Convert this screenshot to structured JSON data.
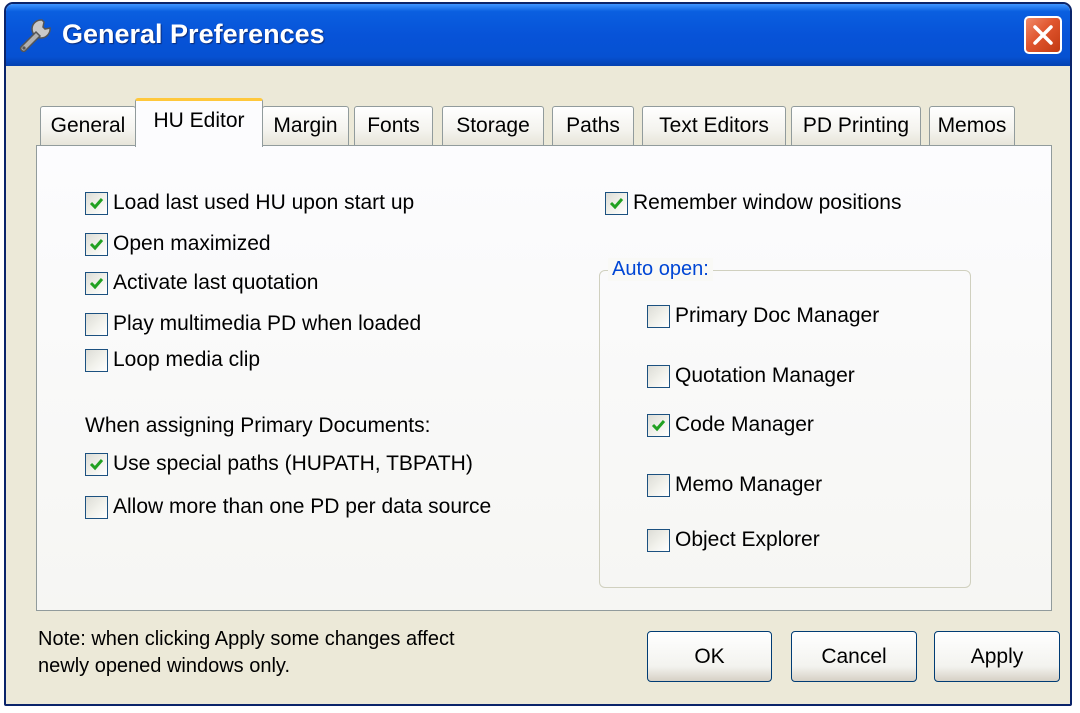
{
  "window": {
    "title": "General Preferences",
    "title_icon": "wrench-icon",
    "close_icon": "close-icon"
  },
  "tabs": [
    {
      "label": "General",
      "active": false
    },
    {
      "label": "HU Editor",
      "active": true
    },
    {
      "label": "Margin",
      "active": false
    },
    {
      "label": "Fonts",
      "active": false
    },
    {
      "label": "Storage",
      "active": false
    },
    {
      "label": "Paths",
      "active": false
    },
    {
      "label": "Text Editors",
      "active": false
    },
    {
      "label": "PD Printing",
      "active": false
    },
    {
      "label": "Memos",
      "active": false
    }
  ],
  "hu_editor": {
    "options": [
      {
        "label": "Load last used HU upon start up",
        "checked": true
      },
      {
        "label": "Open maximized",
        "checked": true
      },
      {
        "label": "Activate last quotation",
        "checked": true
      },
      {
        "label": "Play multimedia PD when loaded",
        "checked": false
      },
      {
        "label": "Loop media clip",
        "checked": false
      }
    ],
    "assign_heading": "When assigning Primary Documents:",
    "assign_options": [
      {
        "label": "Use special paths (HUPATH, TBPATH)",
        "checked": true
      },
      {
        "label": "Allow more than one PD per data source",
        "checked": false
      }
    ],
    "remember_window": {
      "label": "Remember window positions",
      "checked": true
    },
    "auto_open": {
      "legend": "Auto open:",
      "items": [
        {
          "label": "Primary Doc Manager",
          "checked": false
        },
        {
          "label": "Quotation Manager",
          "checked": false
        },
        {
          "label": "Code Manager",
          "checked": true
        },
        {
          "label": "Memo Manager",
          "checked": false
        },
        {
          "label": "Object Explorer",
          "checked": false
        }
      ]
    }
  },
  "footer": {
    "note_line1": "Note: when clicking Apply some changes affect",
    "note_line2": "newly opened windows only.",
    "ok_label": "OK",
    "cancel_label": "Cancel",
    "apply_label": "Apply"
  },
  "colors": {
    "titlebar": "#0753d8",
    "active_tab_highlight": "#ffc83c",
    "check_mark": "#21a121",
    "group_legend": "#0046d5",
    "close_button": "#e0552e"
  }
}
